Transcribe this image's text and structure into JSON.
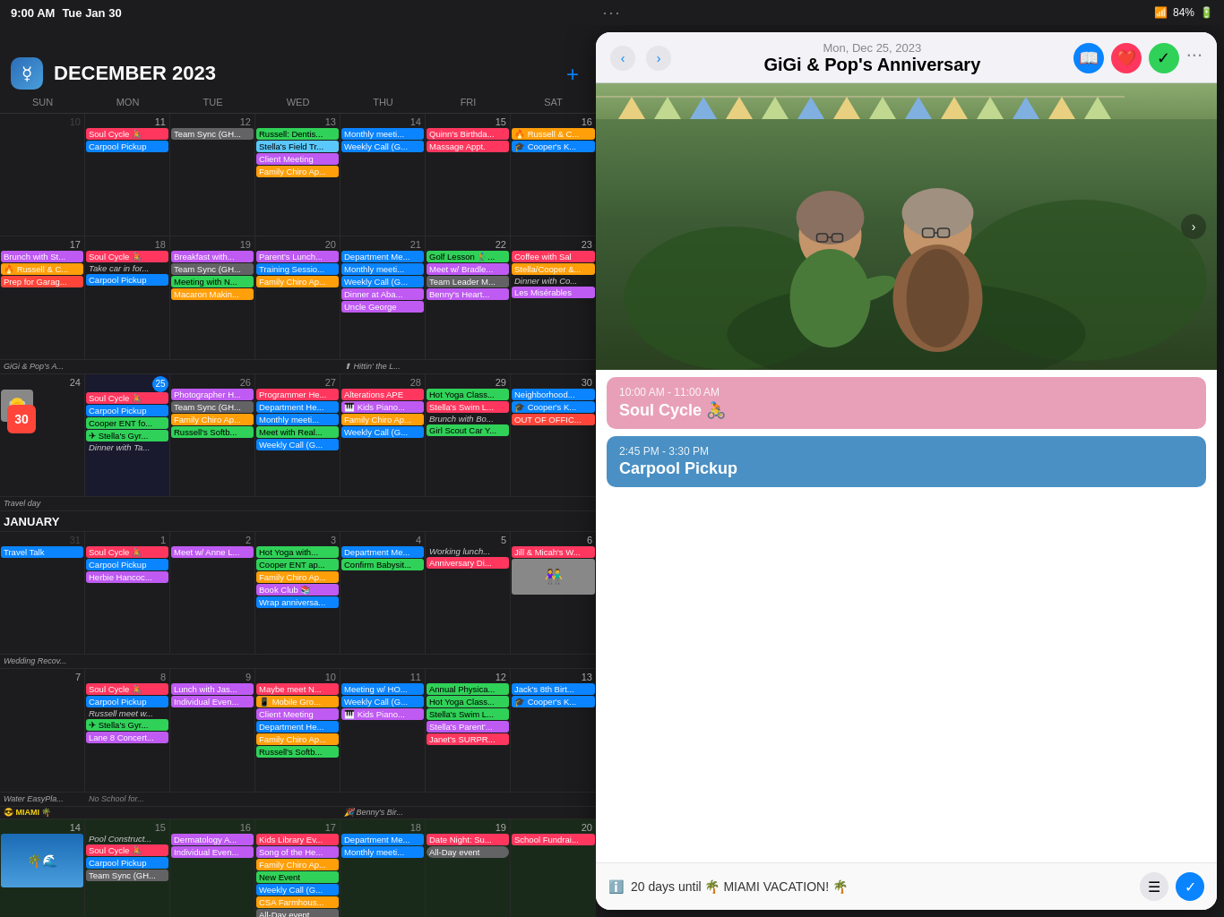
{
  "statusBar": {
    "time": "9:00 AM",
    "day": "Tue Jan 30",
    "dots": "···",
    "wifi": "WiFi",
    "battery": "84%"
  },
  "calendar": {
    "title": "DECEMBER 2023",
    "logo": "📅",
    "addBtn": "+",
    "dayHeaders": [
      "SUN",
      "MON",
      "TUE",
      "WED",
      "THU",
      "FRI",
      "SAT"
    ]
  },
  "detailPanel": {
    "date": "Mon, Dec 25, 2023",
    "eventName": "GiGi & Pop's Anniversary",
    "navPrev": "‹",
    "navNext": "›",
    "moreIcon": "···",
    "event1": {
      "time": "10:00 AM - 11:00 AM",
      "name": "Soul Cycle 🚴"
    },
    "event2": {
      "time": "2:45 PM - 3:30 PM",
      "name": "Carpool Pickup"
    },
    "vacationText": "20 days until 🌴 MIAMI VACATION! 🌴"
  }
}
